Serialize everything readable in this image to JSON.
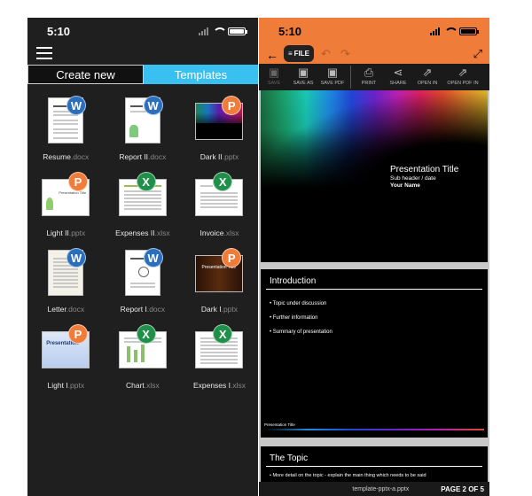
{
  "left": {
    "status_time": "5:10",
    "tabs": {
      "create": "Create new",
      "templates": "Templates"
    },
    "files": [
      {
        "name": "Resume",
        "ext": ".docx",
        "badge": "W"
      },
      {
        "name": "Report II",
        "ext": ".docx",
        "badge": "W"
      },
      {
        "name": "Dark II",
        "ext": ".pptx",
        "badge": "P"
      },
      {
        "name": "Light II",
        "ext": ".pptx",
        "badge": "P"
      },
      {
        "name": "Expenses II",
        "ext": ".xlsx",
        "badge": "X"
      },
      {
        "name": "Invoice",
        "ext": ".xlsx",
        "badge": "X"
      },
      {
        "name": "Letter",
        "ext": ".docx",
        "badge": "W"
      },
      {
        "name": "Report I",
        "ext": ".docx",
        "badge": "W"
      },
      {
        "name": "Dark I",
        "ext": ".pptx",
        "badge": "P"
      },
      {
        "name": "Light I",
        "ext": ".pptx",
        "badge": "P"
      },
      {
        "name": "Chart",
        "ext": ".xlsx",
        "badge": "X"
      },
      {
        "name": "Expenses I",
        "ext": ".xlsx",
        "badge": "X"
      }
    ],
    "thumb_texts": {
      "light2": "Presentation Title",
      "dark1": "Presentation Title",
      "light1": "Presentation"
    }
  },
  "right": {
    "status_time": "5:10",
    "file_button": "FILE",
    "toolbar": [
      {
        "label": "SAVE",
        "icon": "save-icon",
        "disabled": true
      },
      {
        "label": "SAVE AS",
        "icon": "save-as-icon",
        "disabled": false
      },
      {
        "label": "SAVE PDF",
        "icon": "save-pdf-icon",
        "disabled": false
      },
      {
        "label": "PRINT",
        "icon": "printer-icon",
        "disabled": false
      },
      {
        "label": "SHARE",
        "icon": "share-icon",
        "disabled": false
      },
      {
        "label": "OPEN IN",
        "icon": "open-in-icon",
        "disabled": false
      },
      {
        "label": "OPEN PDF IN",
        "icon": "open-pdf-in-icon",
        "disabled": false
      }
    ],
    "slide1": {
      "title": "Presentation Title",
      "subheader": "Sub header / date",
      "name": "Your Name"
    },
    "slide2": {
      "title": "Introduction",
      "bullets": [
        "• Topic under discussion",
        "• Further information",
        "• Summary of presentation"
      ],
      "footer": "Presentation Title"
    },
    "slide3": {
      "title": "The Topic",
      "bullet": "• More detail on the topic - explain the main thing which needs to be said"
    },
    "filename": "template-pptx-a.pptx",
    "page": "PAGE 2 OF 5"
  },
  "colors": {
    "accent_orange": "#f07c3a",
    "tab_blue": "#3ac0f0",
    "word_blue": "#2a6ebd",
    "excel_green": "#1f8f4a"
  }
}
